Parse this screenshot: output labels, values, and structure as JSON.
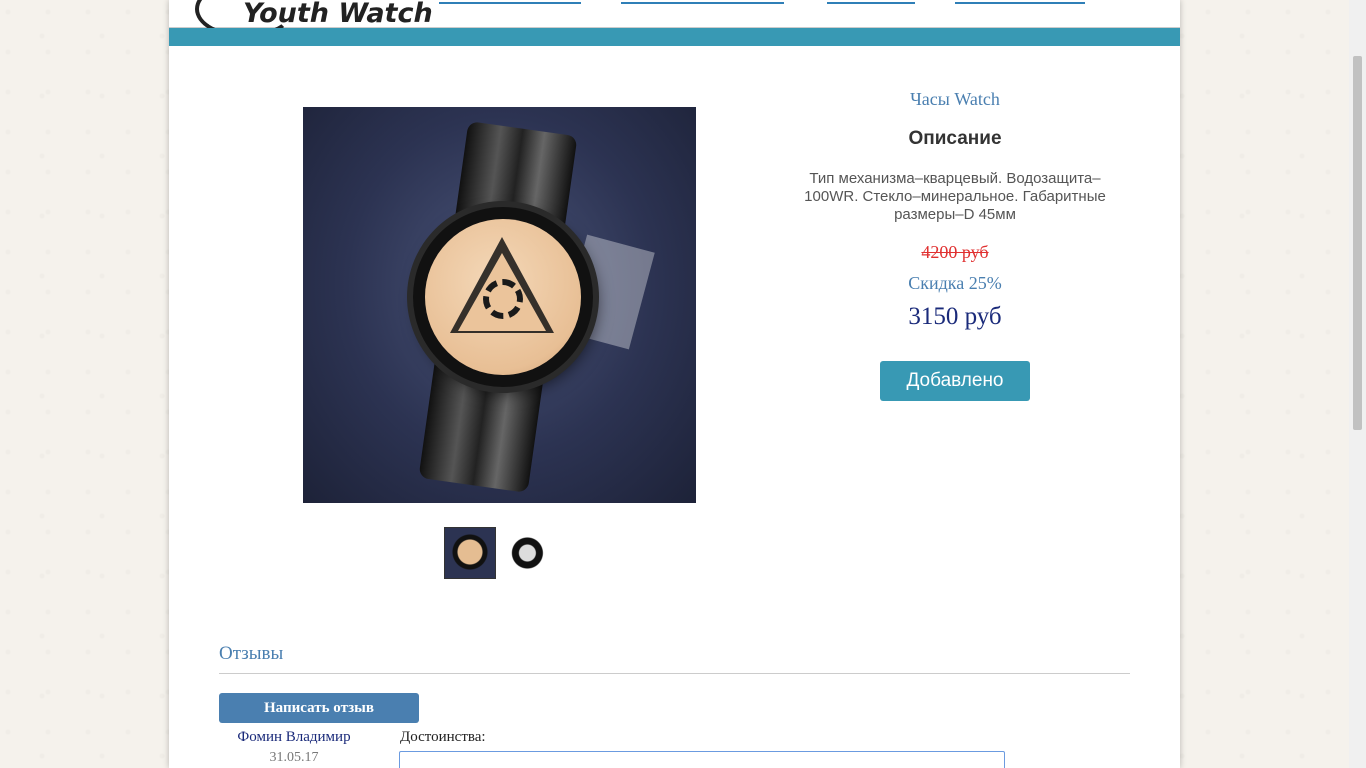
{
  "header": {
    "logo_text": "Youth Watch",
    "nav_items": [
      {
        "icon": "bulb-icon"
      },
      {
        "icon": "cart-icon"
      },
      {
        "icon": "phone-icon"
      },
      {
        "icon": "users-icon"
      }
    ]
  },
  "product": {
    "title": "Часы Watch",
    "description_title": "Описание",
    "description": "Тип механизма–кварцевый. Водозащита–100WR. Стекло–минеральное. Габаритные размеры–D 45мм",
    "old_price": "4200 руб",
    "discount": "Скидка 25%",
    "price": "3150 руб",
    "add_button_label": "Добавлено"
  },
  "reviews": {
    "title": "Отзывы",
    "write_button_label": "Написать отзыв",
    "items": [
      {
        "author": "Фомин Владимир",
        "date": "31.05.17",
        "pros_label": "Достоинства:"
      }
    ]
  },
  "colors": {
    "accent_teal": "#3899b4",
    "link_blue": "#4a7fb0",
    "price_navy": "#1a2a7a",
    "old_price_red": "#e03030"
  }
}
